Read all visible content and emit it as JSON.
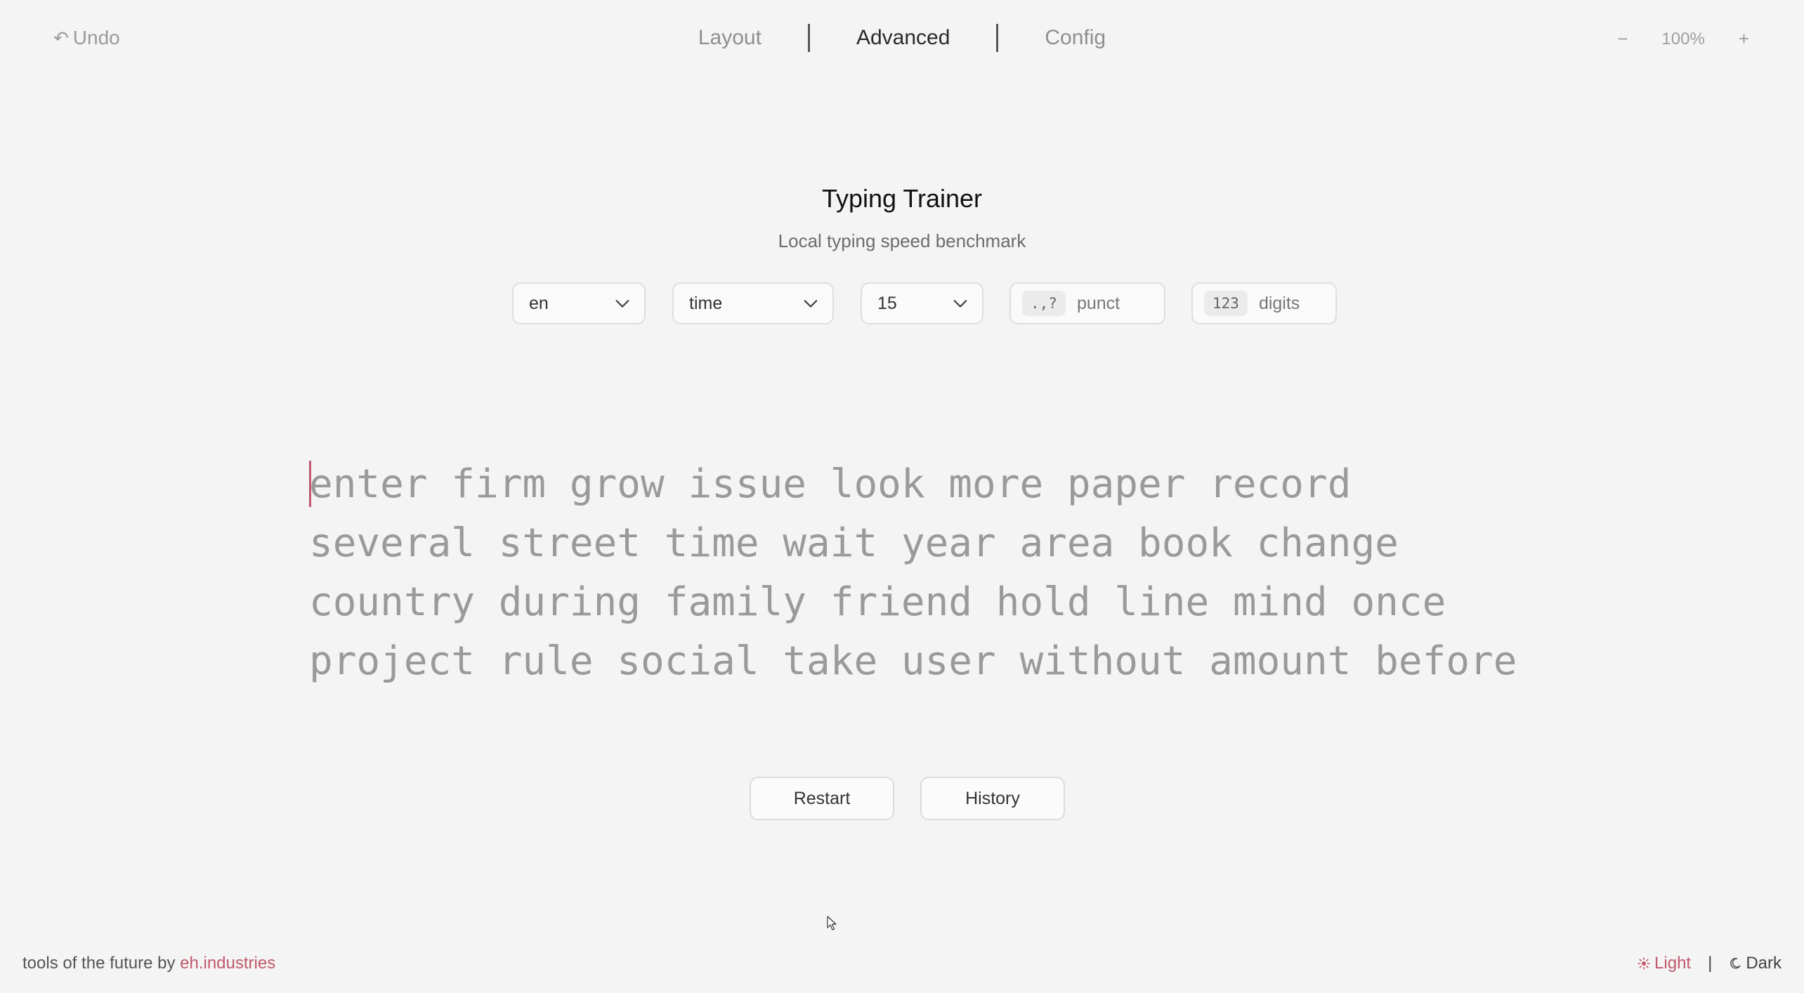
{
  "topbar": {
    "undo_label": "Undo",
    "nav": [
      "Layout",
      "Advanced",
      "Config"
    ],
    "active_tab": "Advanced",
    "zoom_minus": "−",
    "zoom_value": "100%",
    "zoom_plus": "+"
  },
  "header": {
    "title": "Typing Trainer",
    "subtitle": "Local typing speed benchmark"
  },
  "controls": {
    "language": "en",
    "mode": "time",
    "count": "15",
    "punct_badge": ".,?",
    "punct_label": "punct",
    "digits_badge": "123",
    "digits_label": "digits"
  },
  "words": {
    "lines": [
      "enter firm grow issue look more paper record",
      "several street time wait year area book change",
      "country during family friend hold line mind once",
      "project rule social take user without amount before"
    ]
  },
  "actions": {
    "restart_label": "Restart",
    "history_label": "History"
  },
  "footer": {
    "tagline": "tools of the future by ",
    "brand": "eh.industries",
    "light_label": "Light",
    "separator": "|",
    "dark_label": "Dark"
  },
  "colors": {
    "accent": "#c0596b",
    "background": "#f4f4f4",
    "untyped_text": "#9a9a9a"
  }
}
